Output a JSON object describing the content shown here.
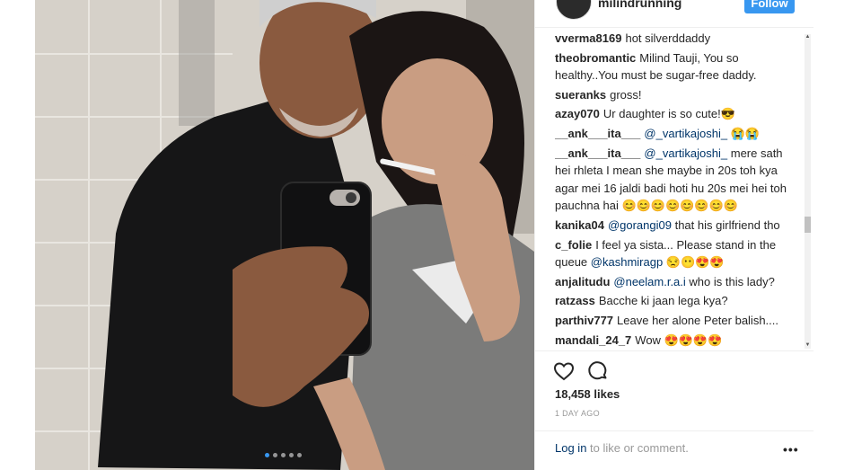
{
  "post": {
    "username": "milindrunning",
    "follow_label": "Follow",
    "likes": "18,458 likes",
    "date": "1 DAY AGO",
    "login_link": "Log in",
    "login_rest": " to like or comment.",
    "more_label": "•••",
    "carousel_count": 5,
    "carousel_active": 0
  },
  "comments": [
    {
      "user": "vverma8169",
      "text": "hot silverddaddy"
    },
    {
      "user": "theobromantic",
      "text": "Milind Tauji, You so healthy..You must be sugar-free daddy."
    },
    {
      "user": "sueranks",
      "text": "gross!"
    },
    {
      "user": "azay070",
      "text": "Ur daughter is so cute!😎"
    },
    {
      "user": "__ank___ita___",
      "mention": "@_vartikajoshi_",
      "text": "😭😭"
    },
    {
      "user": "__ank___ita___",
      "mention": "@_vartikajoshi_",
      "text": "mere sath hei rhleta I mean she maybe in 20s toh kya agar mei 16 jaldi badi hoti hu 20s mei hei toh pauchna hai 😊😊😊😊😊😊😊😊"
    },
    {
      "user": "kanika04",
      "mention": "@gorangi09",
      "text": "that his girlfriend tho"
    },
    {
      "user": "c_folie",
      "text": "I feel ya sista... Please stand in the queue",
      "mention2": "@kashmiragp",
      "text2": "😒😶😍😍"
    },
    {
      "user": "anjalitudu",
      "mention": "@neelam.r.a.i",
      "text": "who is this lady?"
    },
    {
      "user": "ratzass",
      "text": "Bacche ki jaan lega kya?"
    },
    {
      "user": "parthiv777",
      "text": "Leave her alone Peter balish...."
    },
    {
      "user": "mandali_24_7",
      "text": "Wow 😍😍😍😍"
    }
  ],
  "icons": {
    "heart": "heart-icon",
    "comment": "comment-icon",
    "more": "more-options-icon"
  },
  "colors": {
    "accent": "#3897f0",
    "link": "#003569",
    "muted": "#999999",
    "text": "#262626"
  }
}
